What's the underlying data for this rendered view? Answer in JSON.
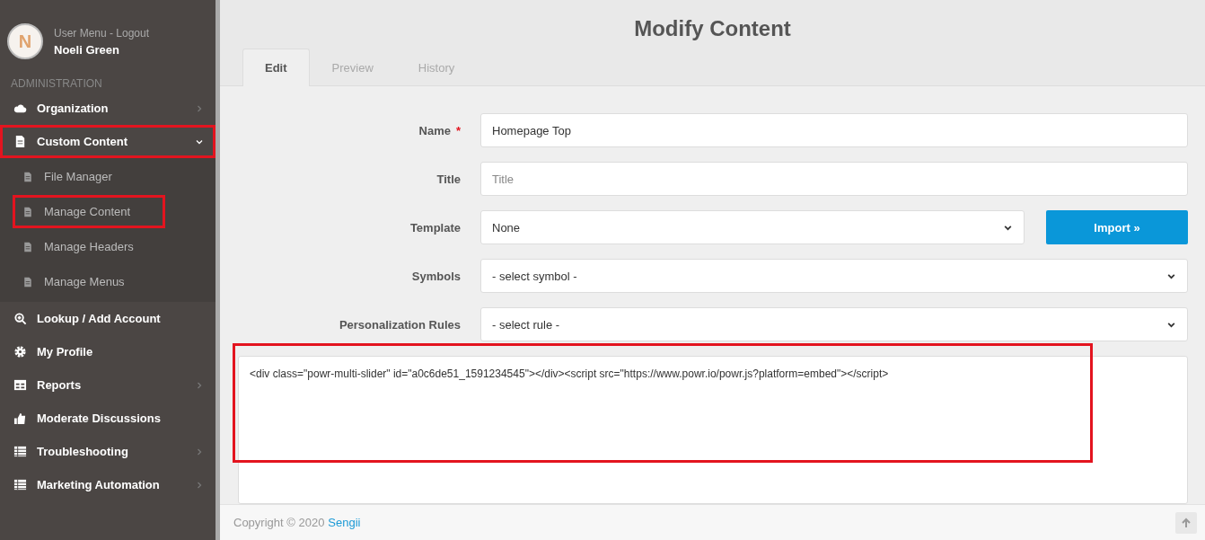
{
  "user": {
    "initial": "N",
    "menu_link": "User Menu - Logout",
    "name": "Noeli Green"
  },
  "sidebar": {
    "section_label": "ADMINISTRATION",
    "items": [
      {
        "label": "Organization",
        "expanded": false,
        "highlighted": false
      },
      {
        "label": "Custom Content",
        "expanded": true,
        "highlighted": true,
        "children": [
          {
            "label": "File Manager",
            "highlighted": false
          },
          {
            "label": "Manage Content",
            "highlighted": true
          },
          {
            "label": "Manage Headers",
            "highlighted": false
          },
          {
            "label": "Manage Menus",
            "highlighted": false
          }
        ]
      },
      {
        "label": "Lookup / Add Account",
        "highlighted": false
      },
      {
        "label": "My Profile",
        "highlighted": false
      },
      {
        "label": "Reports",
        "expanded": false,
        "highlighted": false
      },
      {
        "label": "Moderate Discussions",
        "highlighted": false
      },
      {
        "label": "Troubleshooting",
        "expanded": false,
        "highlighted": false
      },
      {
        "label": "Marketing Automation",
        "expanded": false,
        "highlighted": false
      }
    ]
  },
  "page_title": "Modify Content",
  "tabs": [
    {
      "label": "Edit",
      "selected": true
    },
    {
      "label": "Preview",
      "selected": false
    },
    {
      "label": "History",
      "selected": false
    }
  ],
  "form": {
    "fields": [
      {
        "kind": "text",
        "label": "Name",
        "required_mark": "*",
        "value": "Homepage Top"
      },
      {
        "kind": "text",
        "label": "Title",
        "placeholder": "Title"
      },
      {
        "kind": "select",
        "label": "Template",
        "value": "None",
        "button": "Import »"
      },
      {
        "kind": "select",
        "label": "Symbols",
        "value": "- select symbol -"
      },
      {
        "kind": "select",
        "label": "Personalization Rules",
        "value": "- select rule -"
      }
    ],
    "content": {
      "value": "<div class=\"powr-multi-slider\" id=\"a0c6de51_1591234545\"></div><script src=\"https://www.powr.io/powr.js?platform=embed\"></script>",
      "highlighted": true
    }
  },
  "footer": {
    "copyright": "Copyright © 2020",
    "link": "Sengii"
  }
}
